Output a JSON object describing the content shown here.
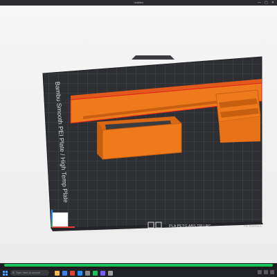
{
  "window": {
    "title": "Untitled",
    "minimize": "—",
    "maximize": "▢",
    "close": "✕"
  },
  "plate": {
    "side_label": "Bambu Smooth PEI Plate / High Temp Plate",
    "bottom_label": "PLA PETG ABS TPU PC",
    "corner_label": "PEI SURFACE",
    "colors": {
      "plate": "#2e2f33",
      "grid": "#4b4d52",
      "model": "#ef7a1c",
      "model_shade": "#c75e10",
      "model_edge": "#e01e1e",
      "axis_x": "#e53935",
      "axis_y": "#1e88e5",
      "axis_z": "#43a047"
    }
  },
  "progress": {
    "value": 1.0,
    "color": "#19c25a"
  },
  "taskbar": {
    "search_placeholder": "Type here to search",
    "pinned_icons": [
      {
        "name": "file-explorer-icon",
        "color": "#f2b84b"
      },
      {
        "name": "browser-icon",
        "color": "#3b82f6"
      },
      {
        "name": "chrome-icon",
        "color": "#e34133"
      },
      {
        "name": "mail-icon",
        "color": "#1e90ff"
      },
      {
        "name": "store-icon",
        "color": "#8a8a8a"
      },
      {
        "name": "bambu-studio-icon",
        "color": "#19c25a"
      },
      {
        "name": "photos-icon",
        "color": "#7b5cff"
      },
      {
        "name": "settings-icon",
        "color": "#9e9e9e"
      }
    ]
  }
}
